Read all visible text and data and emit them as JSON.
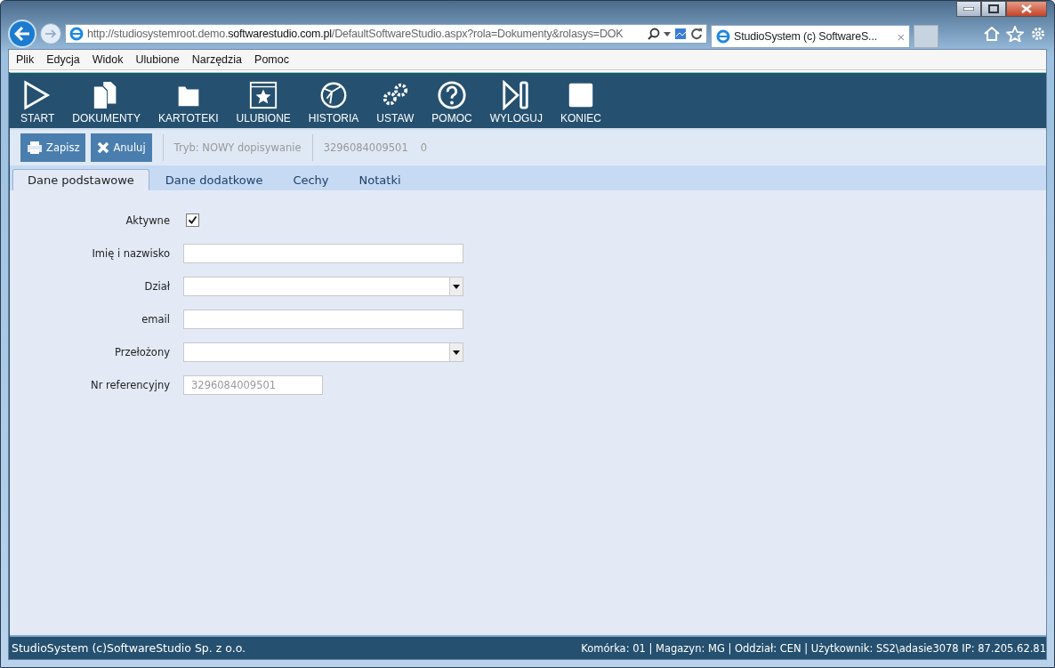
{
  "browser": {
    "url": "http://studiosystemroot.demo.**softwarestudio.com.pl**/DefaultSoftwareStudio.aspx?rola=Dokumenty&rolasys=DOK",
    "tab_title": "StudioSystem (c) SoftwareS...",
    "tab_close": "×"
  },
  "menu": [
    "Plik",
    "Edycja",
    "Widok",
    "Ulubione",
    "Narzędzia",
    "Pomoc"
  ],
  "toolbar": [
    {
      "label": "START"
    },
    {
      "label": "DOKUMENTY"
    },
    {
      "label": "KARTOTEKI"
    },
    {
      "label": "ULUBIONE"
    },
    {
      "label": "HISTORIA"
    },
    {
      "label": "USTAW"
    },
    {
      "label": "POMOC"
    },
    {
      "label": "WYLOGUJ"
    },
    {
      "label": "KONIEC"
    }
  ],
  "actions": {
    "buttons": [
      {
        "label": "Zapisz",
        "kind": "save"
      },
      {
        "label": "Anuluj",
        "kind": "cancel"
      }
    ],
    "mode": "Tryb: NOWY dopisywanie",
    "number": "3296084009501",
    "count": "0"
  },
  "tabs": [
    {
      "label": "Dane podstawowe",
      "selected": true
    },
    {
      "label": "Dane dodatkowe",
      "selected": false
    },
    {
      "label": "Cechy",
      "selected": false
    },
    {
      "label": "Notatki",
      "selected": false
    }
  ],
  "fields": [
    {
      "label": "Aktywne",
      "kind": "checkbox",
      "checked": true
    },
    {
      "label": "Imię i nazwisko",
      "kind": "text"
    },
    {
      "label": "Dział",
      "kind": "select"
    },
    {
      "label": "email",
      "kind": "text"
    },
    {
      "label": "Przełożony",
      "kind": "select"
    },
    {
      "label": "Nr referencyjny",
      "kind": "readonly",
      "value": "3296084009501"
    }
  ],
  "status_bar": {
    "left": "StudioSystem (c)SoftwareStudio Sp. z o.o.",
    "right": "Komórka: 01 | Magazyn: MG | Oddział: CEN | Użytkownik: SS2\\adasie3078 IP: 87.205.62.81"
  }
}
